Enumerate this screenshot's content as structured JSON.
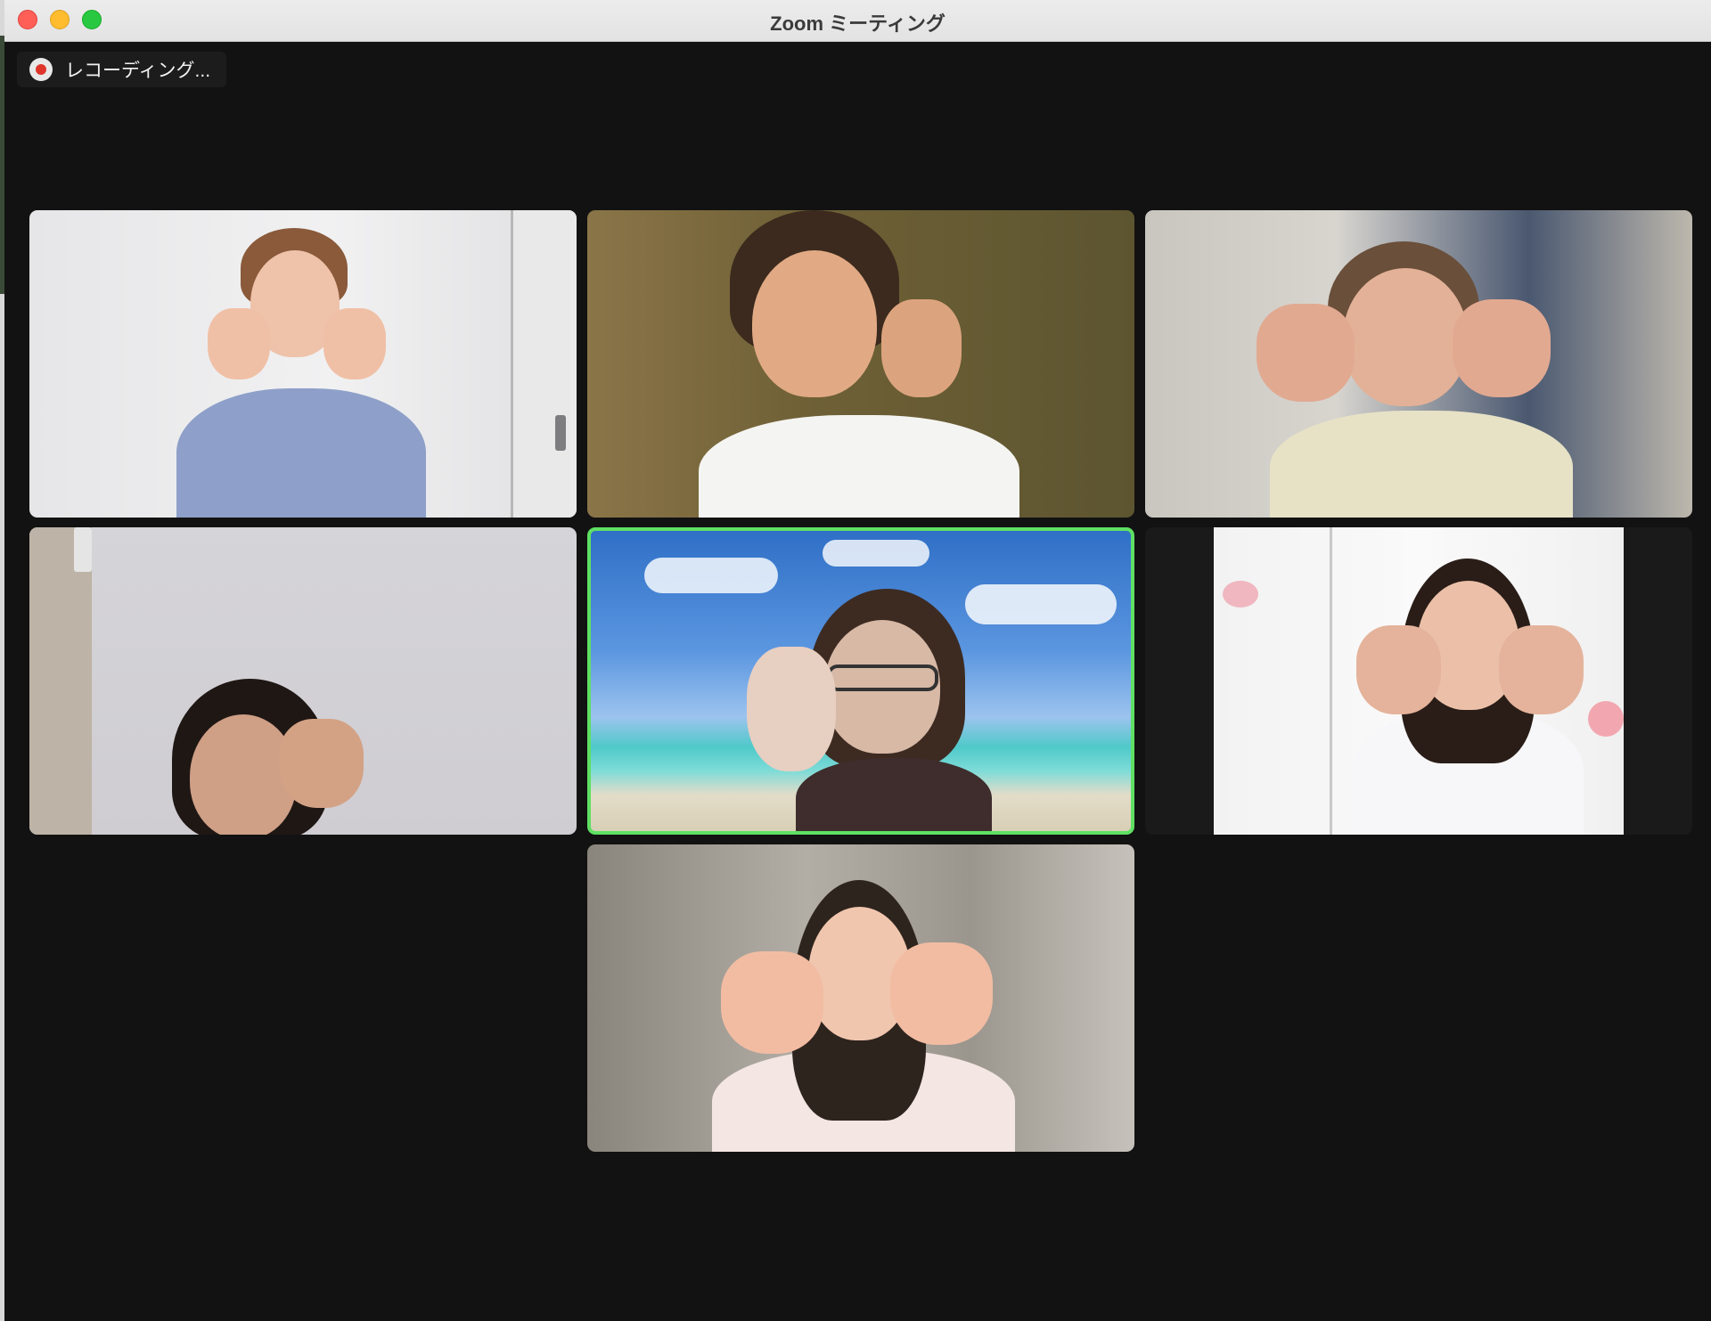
{
  "window": {
    "title": "Zoom ミーティング"
  },
  "recording": {
    "label": "レコーディング..."
  },
  "colors": {
    "active_speaker_border": "#5fe063",
    "background": "#121212",
    "recording_dot": "#e0352b"
  },
  "participants": [
    {
      "id": 1,
      "background": "white room with door",
      "active": false
    },
    {
      "id": 2,
      "background": "olive-brown wall",
      "active": false
    },
    {
      "id": 3,
      "background": "blurred room",
      "active": false
    },
    {
      "id": 4,
      "background": "light grey wall",
      "active": false
    },
    {
      "id": 5,
      "background": "beach and blue sky",
      "active": true
    },
    {
      "id": 6,
      "background": "white wall with pink flowers",
      "active": false
    },
    {
      "id": 7,
      "background": "blurred room",
      "active": false
    }
  ]
}
